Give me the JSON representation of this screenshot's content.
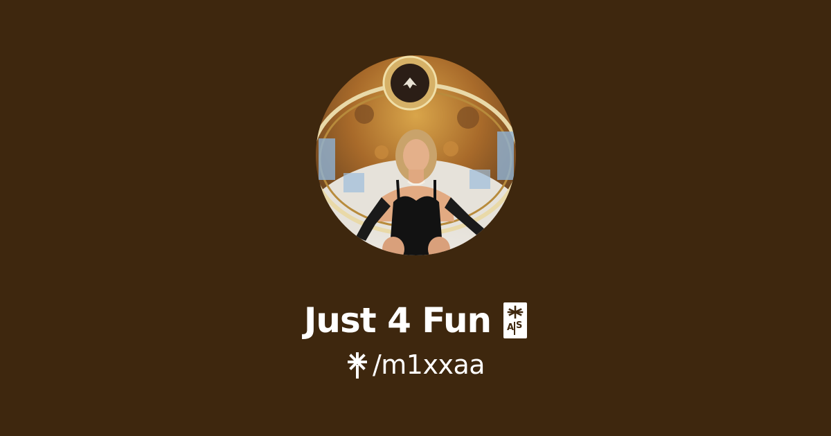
{
  "profile": {
    "title": "Just 4 Fun",
    "title_glyph_icon": "linktree-asterisk-glyph-icon",
    "handle": "/m1xxaa",
    "handle_icon": "linktree-logo-icon",
    "avatar": "profile-photo-avatar"
  },
  "colors": {
    "background": "#3e270e",
    "text": "#ffffff"
  }
}
